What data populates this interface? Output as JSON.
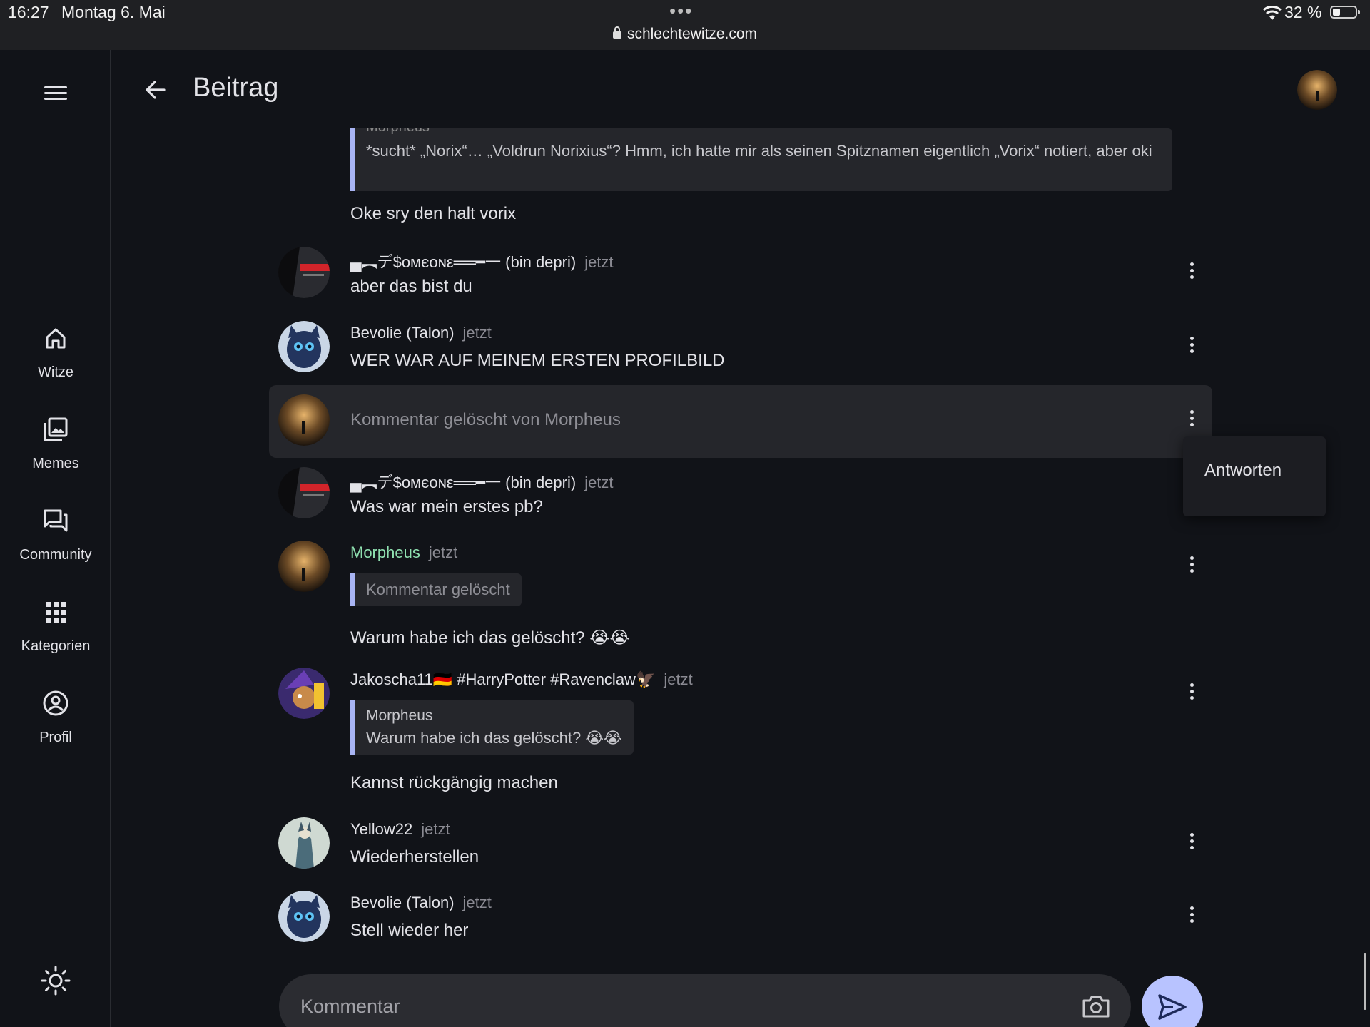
{
  "status_bar": {
    "time": "16:27",
    "date": "Montag 6. Mai",
    "dots": "•••",
    "url": "schlechtewitze.com",
    "battery": "32 %"
  },
  "sidebar": {
    "items": [
      {
        "label": "Witze",
        "icon": "home-icon"
      },
      {
        "label": "Memes",
        "icon": "images-icon"
      },
      {
        "label": "Community",
        "icon": "forum-icon"
      },
      {
        "label": "Kategorien",
        "icon": "grid-icon"
      },
      {
        "label": "Profil",
        "icon": "profile-icon"
      }
    ]
  },
  "header": {
    "title": "Beitrag"
  },
  "thread": {
    "top_quote_faded": "Morpheus",
    "top_quote": "*sucht* „Norix“… „Voldrun Norixius“? Hmm, ich hatte mir als seinen Spitznamen eigentlich „Vorix“ notiert, aber oki",
    "top_text": "Oke sry den halt vorix",
    "comments": [
      {
        "author": "▄︻デ$ᴏмєᴏɴε══━一 (bin depri)",
        "time": "jetzt",
        "body": "aber das bist du"
      },
      {
        "author": "Bevolie (Talon)",
        "time": "jetzt",
        "body": "WER WAR AUF MEINEM ERSTEN PROFILBILD"
      },
      {
        "deleted": "Kommentar gelöscht von Morpheus"
      },
      {
        "author": "▄︻デ$ᴏмєᴏɴε══━一 (bin depri)",
        "time": "jetzt",
        "body": "Was war mein erstes pb?"
      },
      {
        "author": "Morpheus",
        "time": "jetzt",
        "quote": "Kommentar gelöscht",
        "body": "Warum habe ich das gelöscht? 😭😭"
      },
      {
        "author": "Jakoscha11🇩🇪 #HarryPotter #Ravenclaw🦅",
        "time": "jetzt",
        "quote_author": "Morpheus",
        "quote": "Warum habe ich das gelöscht? 😭😭",
        "body": "Kannst rückgängig machen"
      },
      {
        "author": "Yellow22",
        "time": "jetzt",
        "body": "Wiederherstellen"
      },
      {
        "author": "Bevolie (Talon)",
        "time": "jetzt",
        "body": "Stell wieder her"
      }
    ]
  },
  "context_menu": {
    "reply": "Antworten"
  },
  "composer": {
    "placeholder": "Kommentar"
  },
  "colors": {
    "background": "#111318",
    "accent": "#b8c3ff",
    "quote_bar": "#a8b4f3",
    "author_highlight": "#8fe0b0"
  }
}
